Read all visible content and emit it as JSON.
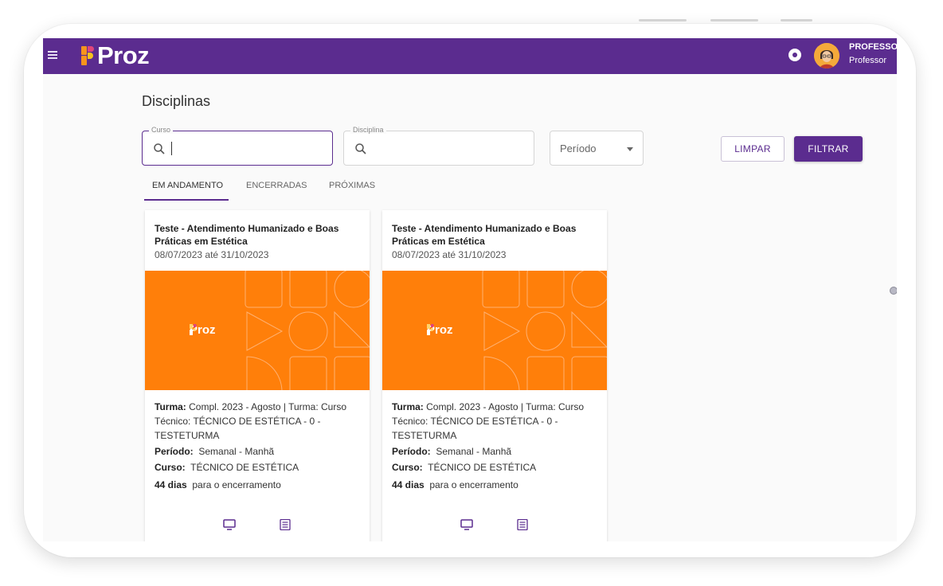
{
  "app": {
    "logo_text": "Proz",
    "user_name": "PROFESSOR",
    "user_role": "Professor"
  },
  "page": {
    "title": "Disciplinas"
  },
  "filters": {
    "curso_label": "Curso",
    "curso_value": "",
    "disciplina_label": "Disciplina",
    "periodo_placeholder": "Período",
    "clear_label": "LIMPAR",
    "filter_label": "FILTRAR"
  },
  "tabs": [
    {
      "label": "EM ANDAMENTO",
      "active": true
    },
    {
      "label": "ENCERRADAS",
      "active": false
    },
    {
      "label": "PRÓXIMAS",
      "active": false
    }
  ],
  "cards": [
    {
      "title": "Teste - Atendimento Humanizado e Boas Práticas em Estética",
      "dates": "08/07/2023 até 31/10/2023",
      "banner_logo": "Proz",
      "turma_label": "Turma:",
      "turma_value": "Compl. 2023 - Agosto | Turma: Curso Técnico: TÉCNICO DE ESTÉTICA - 0 - TESTETURMA",
      "periodo_label": "Período:",
      "periodo_value": "Semanal - Manhã",
      "curso_label": "Curso:",
      "curso_value": "TÉCNICO DE ESTÉTICA",
      "days_label": "44 dias",
      "days_suffix": "para o encerramento"
    },
    {
      "title": "Teste - Atendimento Humanizado e Boas Práticas em Estética",
      "dates": "08/07/2023 até 31/10/2023",
      "banner_logo": "Proz",
      "turma_label": "Turma:",
      "turma_value": "Compl. 2023 - Agosto | Turma: Curso Técnico: TÉCNICO DE ESTÉTICA - 0 - TESTETURMA",
      "periodo_label": "Período:",
      "periodo_value": "Semanal - Manhã",
      "curso_label": "Curso:",
      "curso_value": "TÉCNICO DE ESTÉTICA",
      "days_label": "44 dias",
      "days_suffix": "para o encerramento"
    }
  ],
  "colors": {
    "brand_purple": "#5b2c8f",
    "banner_orange": "#ff7f0a",
    "logo_orange": "#f7941d",
    "logo_pink": "#e0457b"
  },
  "icons": [
    "menu-icon",
    "notification-icon",
    "search-icon",
    "dropdown-arrow-icon",
    "monitor-icon",
    "list-icon"
  ]
}
